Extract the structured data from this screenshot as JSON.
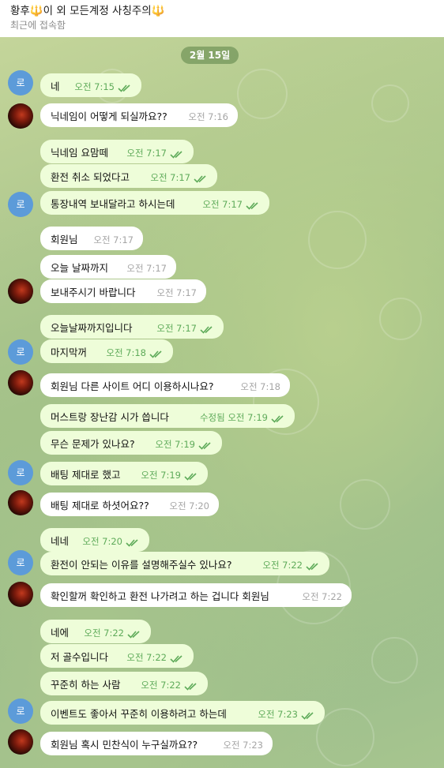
{
  "header": {
    "title_left": "황후",
    "title_mid": "이 외 모든계정 사칭주의",
    "trident_glyph": "🔱",
    "subtitle": "최근에 접속함"
  },
  "date_separator": "2월 15일",
  "avatar_label": "로",
  "messages": [
    {
      "side": "out",
      "text": "네",
      "time": "오전 7:15"
    },
    {
      "side": "in",
      "text": "닉네임이 어떻게 되실까요??",
      "time": "오전 7:16"
    },
    {
      "side": "out",
      "text": "닉네임 요맘떼",
      "time": "오전 7:17"
    },
    {
      "side": "out",
      "text": "환전 취소 되었다고",
      "time": "오전 7:17"
    },
    {
      "side": "out",
      "text": "통장내역 보내달라고 하시는데",
      "time": "오전 7:17"
    },
    {
      "side": "in",
      "text": "회원님",
      "time": "오전 7:17"
    },
    {
      "side": "in",
      "text": "오늘 날짜까지",
      "time": "오전 7:17"
    },
    {
      "side": "in",
      "text": "보내주시기 바랍니다",
      "time": "오전 7:17"
    },
    {
      "side": "out",
      "text": "오늘날짜까지입니다",
      "time": "오전 7:17"
    },
    {
      "side": "out",
      "text": "마지막꺼",
      "time": "오전 7:18"
    },
    {
      "side": "in",
      "text": "회원님 다른 사이트 어디 이용하시나요?",
      "time": "오전 7:18"
    },
    {
      "side": "out",
      "text": "머스트랑 장난감 시가 씁니다",
      "time": "수정됨 오전 7:19"
    },
    {
      "side": "out",
      "text": "무슨 문제가 있나요?",
      "time": "오전 7:19"
    },
    {
      "side": "out",
      "text": "배팅 제대로 했고",
      "time": "오전 7:19"
    },
    {
      "side": "in",
      "text": "배팅 제대로 하셧어요??",
      "time": "오전 7:20"
    },
    {
      "side": "out",
      "text": "네네",
      "time": "오전 7:20"
    },
    {
      "side": "out",
      "text": "환전이 안되는 이유를 설명해주실수 있나요?",
      "time": "오전 7:22"
    },
    {
      "side": "in",
      "text": "확인할꺼 확인하고 환전 나가려고 하는 겁니다 회원님",
      "time": "오전 7:22"
    },
    {
      "side": "out",
      "text": "네에",
      "time": "오전 7:22"
    },
    {
      "side": "out",
      "text": "저 골수입니다",
      "time": "오전 7:22"
    },
    {
      "side": "out",
      "text": "꾸준히 하는 사람",
      "time": "오전 7:22"
    },
    {
      "side": "out",
      "text": "이벤트도 좋아서 꾸준히 이용하려고 하는데",
      "time": "오전 7:23"
    },
    {
      "side": "in",
      "text": "회원님 혹시 민찬식이 누구실까요??",
      "time": "오전 7:23"
    }
  ]
}
